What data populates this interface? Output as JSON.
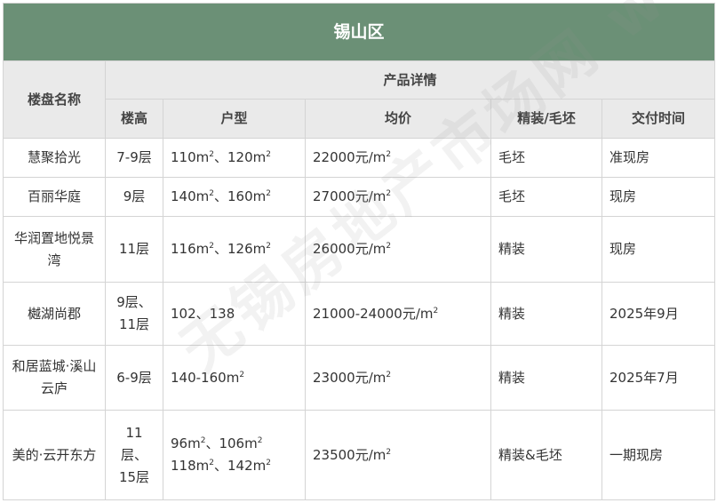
{
  "title": "锡山区",
  "headers": {
    "name": "楼盘名称",
    "details": "产品详情",
    "floors": "楼高",
    "unit": "户型",
    "price": "均价",
    "finish": "精装/毛坯",
    "delivery": "交付时间"
  },
  "unit_symbol": "m",
  "unit_sup": "2",
  "price_suffix": "元/m",
  "rows": [
    {
      "name": [
        "慧聚拾光"
      ],
      "floors": [
        "7-9层"
      ],
      "unit_lines": [
        [
          {
            "v": "110",
            "u": true
          },
          {
            "v": "、120",
            "u": true
          }
        ]
      ],
      "price": "22000",
      "finish": "毛坯",
      "delivery": "准现房"
    },
    {
      "name": [
        "百丽华庭"
      ],
      "floors": [
        "9层"
      ],
      "unit_lines": [
        [
          {
            "v": "140",
            "u": true
          },
          {
            "v": "、160",
            "u": true
          }
        ]
      ],
      "price": "27000",
      "finish": "毛坯",
      "delivery": "现房"
    },
    {
      "name": [
        "华润置地悦景",
        "湾"
      ],
      "floors": [
        "11层"
      ],
      "unit_lines": [
        [
          {
            "v": "116",
            "u": true
          },
          {
            "v": "、126",
            "u": true
          }
        ]
      ],
      "price": "26000",
      "finish": "精装",
      "delivery": "现房"
    },
    {
      "name": [
        "樾湖尚郡"
      ],
      "floors": [
        "9层、",
        "11层"
      ],
      "unit_lines": [
        [
          {
            "v": "102、138",
            "u": false
          }
        ]
      ],
      "price": "21000-24000",
      "finish": "精装",
      "delivery": "2025年9月"
    },
    {
      "name": [
        "和居蓝城·溪山",
        "云庐"
      ],
      "floors": [
        "6-9层"
      ],
      "unit_lines": [
        [
          {
            "v": "140-160",
            "u": true
          }
        ]
      ],
      "price": "23000",
      "finish": "精装",
      "delivery": "2025年7月"
    },
    {
      "name": [
        "美的·云开东方"
      ],
      "floors": [
        "11",
        "层、",
        "15层"
      ],
      "unit_lines": [
        [
          {
            "v": "96",
            "u": true
          },
          {
            "v": "、106",
            "u": true
          }
        ],
        [
          {
            "v": "118",
            "u": true
          },
          {
            "v": "、142",
            "u": true
          }
        ]
      ],
      "price": "23500",
      "finish": "精装&毛坯",
      "delivery": "一期现房"
    }
  ],
  "watermark": "无锡房地产市场网 www.wxhouse.com"
}
